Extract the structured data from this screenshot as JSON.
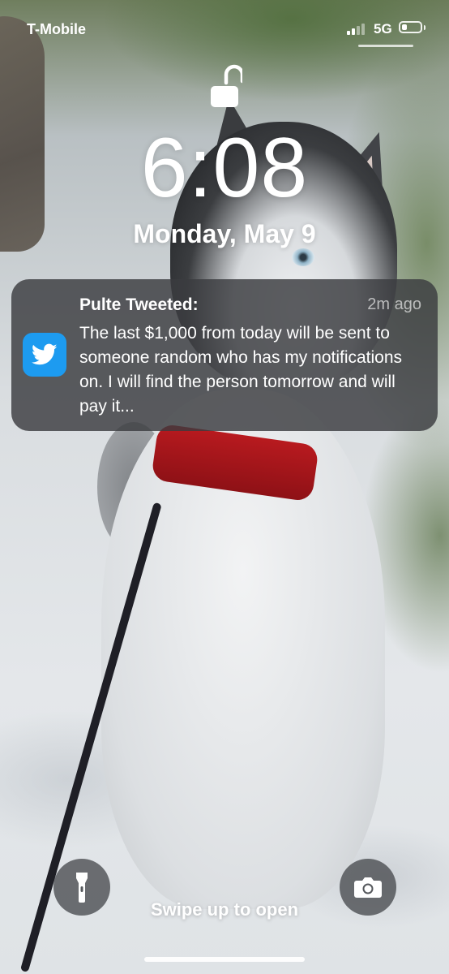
{
  "status_bar": {
    "carrier": "T-Mobile",
    "network": "5G",
    "signal_bars_active": 2,
    "signal_bars_total": 4,
    "battery_level": 0.3
  },
  "lock_screen": {
    "time": "6:08",
    "date": "Monday, May 9",
    "lock_state": "unlocked",
    "swipe_hint": "Swipe up to open"
  },
  "notification": {
    "app_icon": "twitter-bird-icon",
    "app_color": "#1d9bf0",
    "title": "Pulte Tweeted:",
    "time_ago": "2m ago",
    "body": "The last $1,000 from today will be sent to someone random who has my notifications on. I will find the person tomorrow and will pay it..."
  },
  "quick_actions": {
    "left": "flashlight-icon",
    "right": "camera-icon"
  }
}
